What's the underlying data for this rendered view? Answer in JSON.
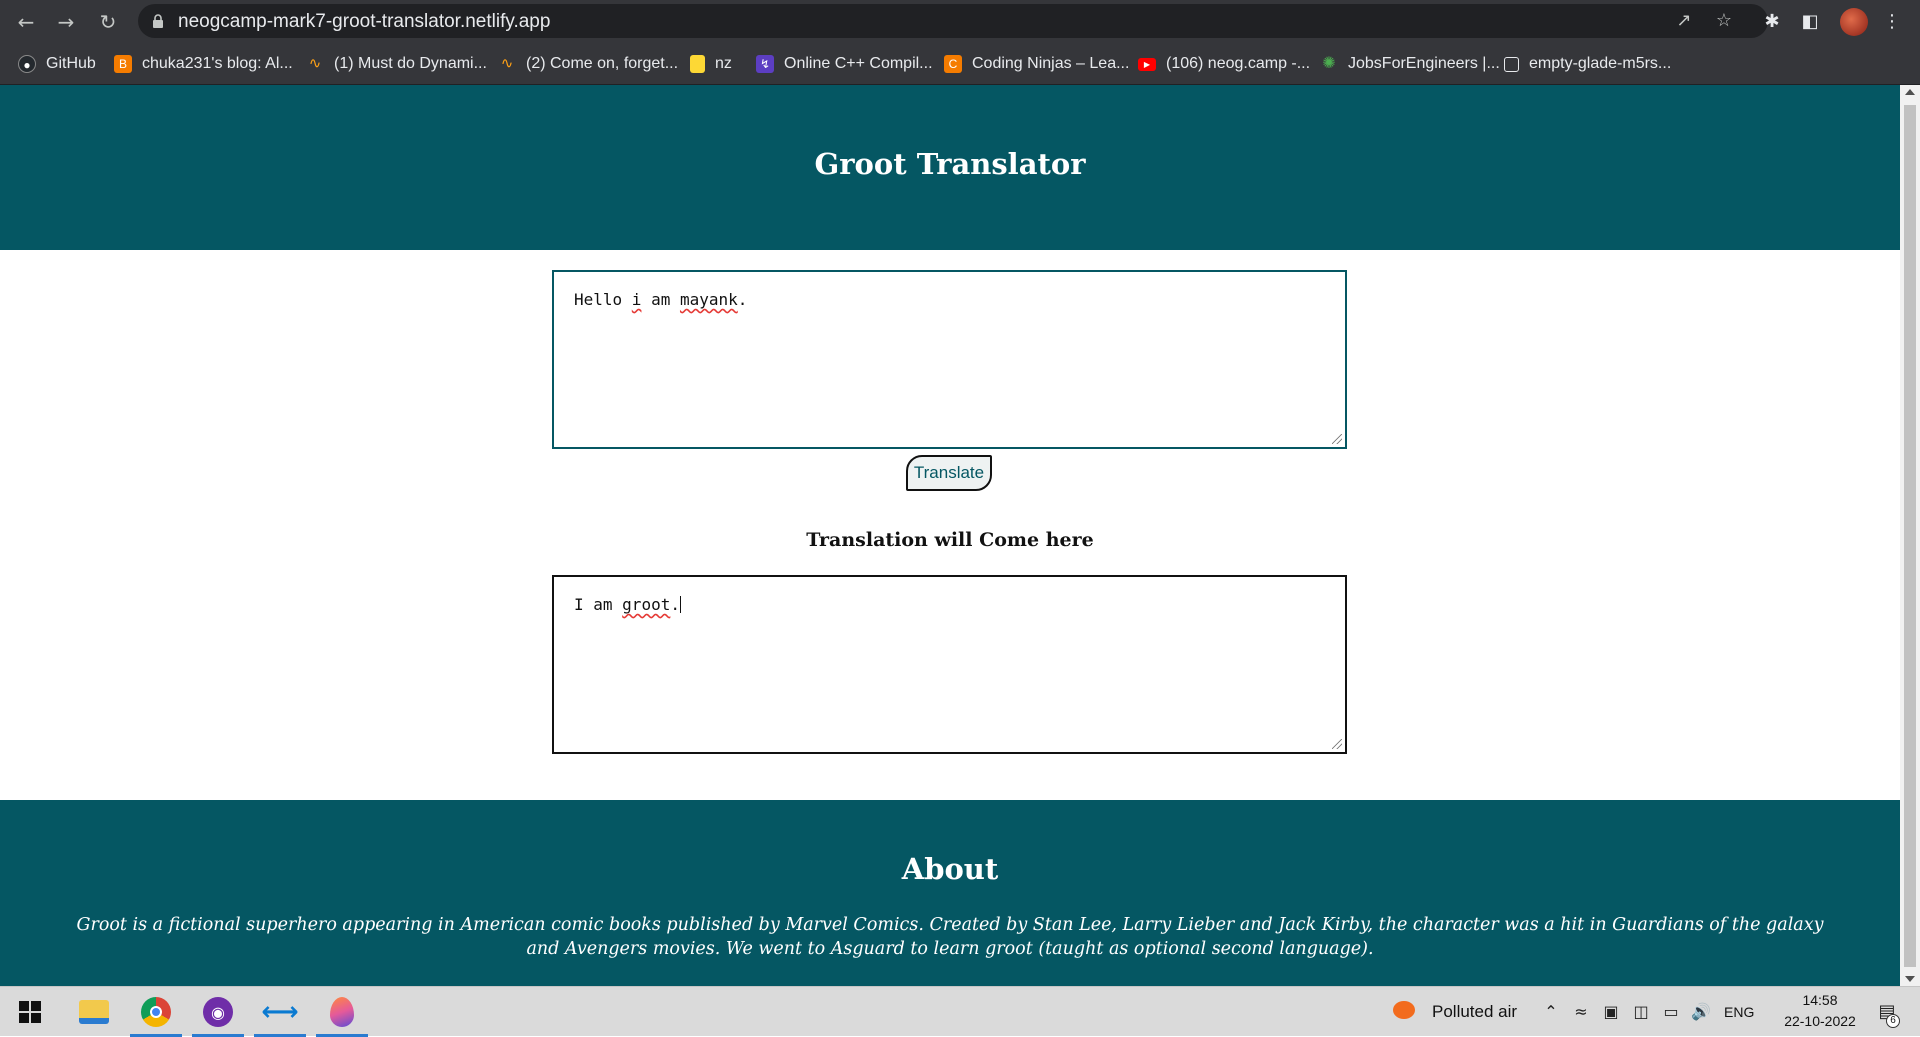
{
  "browser": {
    "url": "neogcamp-mark7-groot-translator.netlify.app",
    "bookmarks": [
      {
        "label": "GitHub",
        "icon": "github-icon",
        "color": "#24292e"
      },
      {
        "label": "chuka231's blog: Al...",
        "icon": "blogger-icon",
        "color": "#f57c00"
      },
      {
        "label": "(1) Must do Dynami...",
        "icon": "leetcode-icon",
        "color": "#ffa116"
      },
      {
        "label": "(2) Come on, forget...",
        "icon": "leetcode-icon",
        "color": "#ffa116"
      },
      {
        "label": "nz",
        "icon": "folder-note-icon",
        "color": "#fdd835"
      },
      {
        "label": "Online C++ Compil...",
        "icon": "replit-bolt-icon",
        "color": "#5c3ec2"
      },
      {
        "label": "Coding Ninjas – Lea...",
        "icon": "coding-ninjas-icon",
        "color": "#f57c00"
      },
      {
        "label": "(106) neog.camp -...",
        "icon": "youtube-icon",
        "color": "#ff0000"
      },
      {
        "label": "JobsForEngineers |...",
        "icon": "jobs-icon",
        "color": "#2e7d32"
      },
      {
        "label": "empty-glade-m5rs...",
        "icon": "blank-page-icon",
        "color": "#ffffff"
      }
    ]
  },
  "page": {
    "header_title": "Groot Translator",
    "input_text": "Hello i am mayank.",
    "input_words": [
      {
        "text": "Hello ",
        "misspelled": false
      },
      {
        "text": "i",
        "misspelled": true
      },
      {
        "text": " am ",
        "misspelled": false
      },
      {
        "text": "mayank",
        "misspelled": true
      },
      {
        "text": ".",
        "misspelled": false
      }
    ],
    "translate_button": "Translate",
    "output_label": "Translation will Come here",
    "output_words": [
      {
        "text": "I am ",
        "misspelled": false
      },
      {
        "text": "groot",
        "misspelled": true
      },
      {
        "text": ".",
        "misspelled": false
      }
    ],
    "about_title": "About",
    "about_text": "Groot is a fictional superhero appearing in American comic books published by Marvel Comics. Created by Stan Lee, Larry Lieber and Jack Kirby, the character was a hit in Guardians of the galaxy and Avengers movies. We went to Asguard to learn groot (taught as optional second language).",
    "colors": {
      "brand": "#055763",
      "background": "#ffffff"
    }
  },
  "taskbar": {
    "apps": [
      {
        "name": "windows-start-icon",
        "color": "#0078d4",
        "active": false
      },
      {
        "name": "file-explorer-icon",
        "color": "#f2c94c",
        "active": false
      },
      {
        "name": "chrome-icon",
        "color": "#db4437",
        "active": true
      },
      {
        "name": "github-desktop-icon",
        "color": "#6f2da8",
        "active": true
      },
      {
        "name": "vscode-icon",
        "color": "#0a7ad1",
        "active": true
      },
      {
        "name": "browser-flame-icon",
        "color": "#e55a9a",
        "active": true
      }
    ],
    "weather": "Polluted air",
    "language": "ENG",
    "time": "14:58",
    "date": "22-10-2022",
    "notification_count": "6"
  }
}
